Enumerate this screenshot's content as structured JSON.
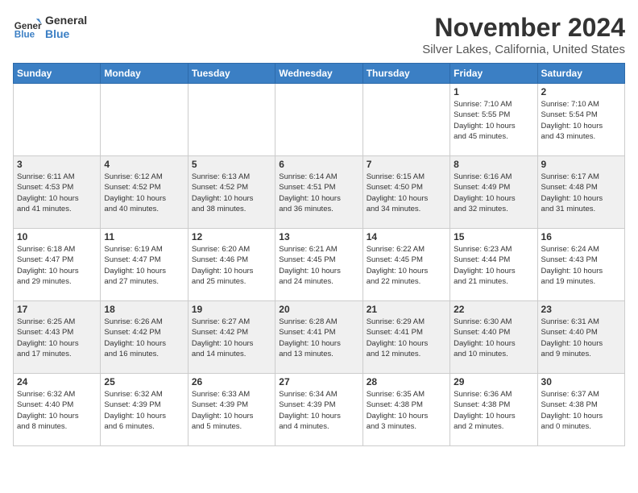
{
  "logo": {
    "line1": "General",
    "line2": "Blue"
  },
  "title": "November 2024",
  "location": "Silver Lakes, California, United States",
  "days_of_week": [
    "Sunday",
    "Monday",
    "Tuesday",
    "Wednesday",
    "Thursday",
    "Friday",
    "Saturday"
  ],
  "weeks": [
    [
      {
        "day": "",
        "info": ""
      },
      {
        "day": "",
        "info": ""
      },
      {
        "day": "",
        "info": ""
      },
      {
        "day": "",
        "info": ""
      },
      {
        "day": "",
        "info": ""
      },
      {
        "day": "1",
        "info": "Sunrise: 7:10 AM\nSunset: 5:55 PM\nDaylight: 10 hours\nand 45 minutes."
      },
      {
        "day": "2",
        "info": "Sunrise: 7:10 AM\nSunset: 5:54 PM\nDaylight: 10 hours\nand 43 minutes."
      }
    ],
    [
      {
        "day": "3",
        "info": "Sunrise: 6:11 AM\nSunset: 4:53 PM\nDaylight: 10 hours\nand 41 minutes."
      },
      {
        "day": "4",
        "info": "Sunrise: 6:12 AM\nSunset: 4:52 PM\nDaylight: 10 hours\nand 40 minutes."
      },
      {
        "day": "5",
        "info": "Sunrise: 6:13 AM\nSunset: 4:52 PM\nDaylight: 10 hours\nand 38 minutes."
      },
      {
        "day": "6",
        "info": "Sunrise: 6:14 AM\nSunset: 4:51 PM\nDaylight: 10 hours\nand 36 minutes."
      },
      {
        "day": "7",
        "info": "Sunrise: 6:15 AM\nSunset: 4:50 PM\nDaylight: 10 hours\nand 34 minutes."
      },
      {
        "day": "8",
        "info": "Sunrise: 6:16 AM\nSunset: 4:49 PM\nDaylight: 10 hours\nand 32 minutes."
      },
      {
        "day": "9",
        "info": "Sunrise: 6:17 AM\nSunset: 4:48 PM\nDaylight: 10 hours\nand 31 minutes."
      }
    ],
    [
      {
        "day": "10",
        "info": "Sunrise: 6:18 AM\nSunset: 4:47 PM\nDaylight: 10 hours\nand 29 minutes."
      },
      {
        "day": "11",
        "info": "Sunrise: 6:19 AM\nSunset: 4:47 PM\nDaylight: 10 hours\nand 27 minutes."
      },
      {
        "day": "12",
        "info": "Sunrise: 6:20 AM\nSunset: 4:46 PM\nDaylight: 10 hours\nand 25 minutes."
      },
      {
        "day": "13",
        "info": "Sunrise: 6:21 AM\nSunset: 4:45 PM\nDaylight: 10 hours\nand 24 minutes."
      },
      {
        "day": "14",
        "info": "Sunrise: 6:22 AM\nSunset: 4:45 PM\nDaylight: 10 hours\nand 22 minutes."
      },
      {
        "day": "15",
        "info": "Sunrise: 6:23 AM\nSunset: 4:44 PM\nDaylight: 10 hours\nand 21 minutes."
      },
      {
        "day": "16",
        "info": "Sunrise: 6:24 AM\nSunset: 4:43 PM\nDaylight: 10 hours\nand 19 minutes."
      }
    ],
    [
      {
        "day": "17",
        "info": "Sunrise: 6:25 AM\nSunset: 4:43 PM\nDaylight: 10 hours\nand 17 minutes."
      },
      {
        "day": "18",
        "info": "Sunrise: 6:26 AM\nSunset: 4:42 PM\nDaylight: 10 hours\nand 16 minutes."
      },
      {
        "day": "19",
        "info": "Sunrise: 6:27 AM\nSunset: 4:42 PM\nDaylight: 10 hours\nand 14 minutes."
      },
      {
        "day": "20",
        "info": "Sunrise: 6:28 AM\nSunset: 4:41 PM\nDaylight: 10 hours\nand 13 minutes."
      },
      {
        "day": "21",
        "info": "Sunrise: 6:29 AM\nSunset: 4:41 PM\nDaylight: 10 hours\nand 12 minutes."
      },
      {
        "day": "22",
        "info": "Sunrise: 6:30 AM\nSunset: 4:40 PM\nDaylight: 10 hours\nand 10 minutes."
      },
      {
        "day": "23",
        "info": "Sunrise: 6:31 AM\nSunset: 4:40 PM\nDaylight: 10 hours\nand 9 minutes."
      }
    ],
    [
      {
        "day": "24",
        "info": "Sunrise: 6:32 AM\nSunset: 4:40 PM\nDaylight: 10 hours\nand 8 minutes."
      },
      {
        "day": "25",
        "info": "Sunrise: 6:32 AM\nSunset: 4:39 PM\nDaylight: 10 hours\nand 6 minutes."
      },
      {
        "day": "26",
        "info": "Sunrise: 6:33 AM\nSunset: 4:39 PM\nDaylight: 10 hours\nand 5 minutes."
      },
      {
        "day": "27",
        "info": "Sunrise: 6:34 AM\nSunset: 4:39 PM\nDaylight: 10 hours\nand 4 minutes."
      },
      {
        "day": "28",
        "info": "Sunrise: 6:35 AM\nSunset: 4:38 PM\nDaylight: 10 hours\nand 3 minutes."
      },
      {
        "day": "29",
        "info": "Sunrise: 6:36 AM\nSunset: 4:38 PM\nDaylight: 10 hours\nand 2 minutes."
      },
      {
        "day": "30",
        "info": "Sunrise: 6:37 AM\nSunset: 4:38 PM\nDaylight: 10 hours\nand 0 minutes."
      }
    ]
  ]
}
